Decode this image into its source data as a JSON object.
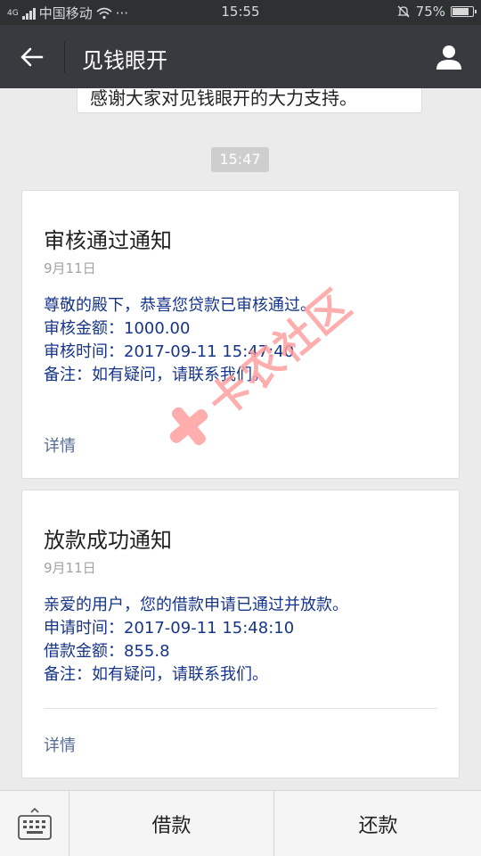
{
  "status_bar": {
    "network": "4G",
    "carrier": "中国移动",
    "more": "···",
    "time": "15:55",
    "battery": "75%"
  },
  "header": {
    "title": "见钱眼开"
  },
  "chat": {
    "previous_message": "感谢大家对见钱眼开的大力支持。",
    "timestamp": "15:47",
    "cards": [
      {
        "title": "审核通过通知",
        "date": "9月11日",
        "lines": [
          "尊敬的殿下，恭喜您贷款已审核通过。",
          "审核金额：1000.00",
          "审核时间：2017-09-11 15:47:40",
          "备注：如有疑问，请联系我们。"
        ],
        "link": "详情"
      },
      {
        "title": "放款成功通知",
        "date": "9月11日",
        "lines": [
          "亲爱的用户，您的借款申请已通过并放款。",
          "申请时间：2017-09-11 15:48:10",
          "借款金额：855.8",
          "备注：如有疑问，请联系我们。"
        ],
        "link": "详情"
      }
    ]
  },
  "watermark": {
    "text": "卡农社区"
  },
  "bottom_menu": {
    "keyboard_icon": "keyboard-icon",
    "items": [
      "借款",
      "还款"
    ]
  },
  "colors": {
    "title_bar": "#393a3f",
    "status_bar": "#2e3132",
    "background": "#ebebeb",
    "body_text": "#16348a",
    "link": "#576b95"
  }
}
